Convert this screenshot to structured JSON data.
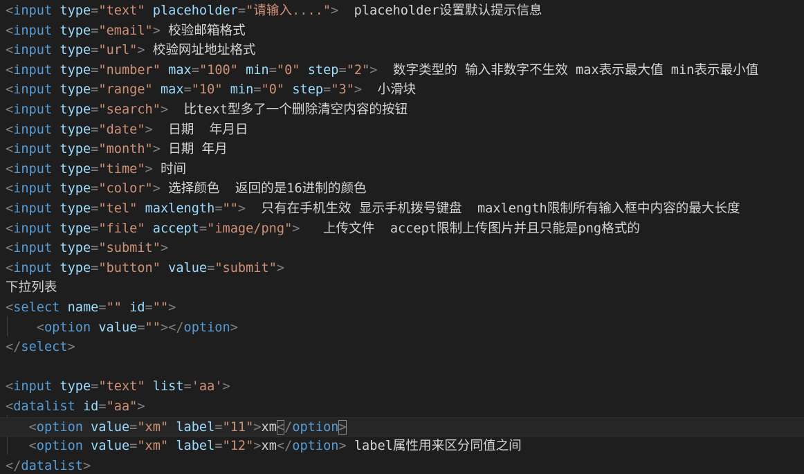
{
  "editor": {
    "lines": [
      [
        [
          "b",
          "<"
        ],
        [
          "t",
          "input"
        ],
        [
          "s",
          " "
        ],
        [
          "a",
          "type"
        ],
        [
          "b",
          "="
        ],
        [
          "v",
          "\"text\""
        ],
        [
          "s",
          " "
        ],
        [
          "a",
          "placeholder"
        ],
        [
          "b",
          "="
        ],
        [
          "v",
          "\"请输入....\""
        ],
        [
          "b",
          ">"
        ],
        [
          "x",
          "  placeholder设置默认提示信息"
        ]
      ],
      [
        [
          "b",
          "<"
        ],
        [
          "t",
          "input"
        ],
        [
          "s",
          " "
        ],
        [
          "a",
          "type"
        ],
        [
          "b",
          "="
        ],
        [
          "v",
          "\"email\""
        ],
        [
          "b",
          ">"
        ],
        [
          "x",
          " 校验邮箱格式"
        ]
      ],
      [
        [
          "b",
          "<"
        ],
        [
          "t",
          "input"
        ],
        [
          "s",
          " "
        ],
        [
          "a",
          "type"
        ],
        [
          "b",
          "="
        ],
        [
          "v",
          "\"url\""
        ],
        [
          "b",
          ">"
        ],
        [
          "x",
          " 校验网址地址格式"
        ]
      ],
      [
        [
          "b",
          "<"
        ],
        [
          "t",
          "input"
        ],
        [
          "s",
          " "
        ],
        [
          "a",
          "type"
        ],
        [
          "b",
          "="
        ],
        [
          "v",
          "\"number\""
        ],
        [
          "s",
          " "
        ],
        [
          "a",
          "max"
        ],
        [
          "b",
          "="
        ],
        [
          "v",
          "\"100\""
        ],
        [
          "s",
          " "
        ],
        [
          "a",
          "min"
        ],
        [
          "b",
          "="
        ],
        [
          "v",
          "\"0\""
        ],
        [
          "s",
          " "
        ],
        [
          "a",
          "step"
        ],
        [
          "b",
          "="
        ],
        [
          "v",
          "\"2\""
        ],
        [
          "b",
          ">"
        ],
        [
          "x",
          "  数字类型的 输入非数字不生效 max表示最大值 min表示最小值"
        ]
      ],
      [
        [
          "b",
          "<"
        ],
        [
          "t",
          "input"
        ],
        [
          "s",
          " "
        ],
        [
          "a",
          "type"
        ],
        [
          "b",
          "="
        ],
        [
          "v",
          "\"range\""
        ],
        [
          "s",
          " "
        ],
        [
          "a",
          "max"
        ],
        [
          "b",
          "="
        ],
        [
          "v",
          "\"10\""
        ],
        [
          "s",
          " "
        ],
        [
          "a",
          "min"
        ],
        [
          "b",
          "="
        ],
        [
          "v",
          "\"0\""
        ],
        [
          "s",
          " "
        ],
        [
          "a",
          "step"
        ],
        [
          "b",
          "="
        ],
        [
          "v",
          "\"3\""
        ],
        [
          "b",
          ">"
        ],
        [
          "x",
          "  小滑块"
        ]
      ],
      [
        [
          "b",
          "<"
        ],
        [
          "t",
          "input"
        ],
        [
          "s",
          " "
        ],
        [
          "a",
          "type"
        ],
        [
          "b",
          "="
        ],
        [
          "v",
          "\"search\""
        ],
        [
          "b",
          ">"
        ],
        [
          "x",
          "  比text型多了一个删除清空内容的按钮"
        ]
      ],
      [
        [
          "b",
          "<"
        ],
        [
          "t",
          "input"
        ],
        [
          "s",
          " "
        ],
        [
          "a",
          "type"
        ],
        [
          "b",
          "="
        ],
        [
          "v",
          "\"date\""
        ],
        [
          "b",
          ">"
        ],
        [
          "x",
          "  日期  年月日"
        ]
      ],
      [
        [
          "b",
          "<"
        ],
        [
          "t",
          "input"
        ],
        [
          "s",
          " "
        ],
        [
          "a",
          "type"
        ],
        [
          "b",
          "="
        ],
        [
          "v",
          "\"month\""
        ],
        [
          "b",
          ">"
        ],
        [
          "x",
          " 日期 年月"
        ]
      ],
      [
        [
          "b",
          "<"
        ],
        [
          "t",
          "input"
        ],
        [
          "s",
          " "
        ],
        [
          "a",
          "type"
        ],
        [
          "b",
          "="
        ],
        [
          "v",
          "\"time\""
        ],
        [
          "b",
          ">"
        ],
        [
          "x",
          " 时间"
        ]
      ],
      [
        [
          "b",
          "<"
        ],
        [
          "t",
          "input"
        ],
        [
          "s",
          " "
        ],
        [
          "a",
          "type"
        ],
        [
          "b",
          "="
        ],
        [
          "v",
          "\"color\""
        ],
        [
          "b",
          ">"
        ],
        [
          "x",
          " 选择颜色  返回的是16进制的颜色"
        ]
      ],
      [
        [
          "b",
          "<"
        ],
        [
          "t",
          "input"
        ],
        [
          "s",
          " "
        ],
        [
          "a",
          "type"
        ],
        [
          "b",
          "="
        ],
        [
          "v",
          "\"tel\""
        ],
        [
          "s",
          " "
        ],
        [
          "a",
          "maxlength"
        ],
        [
          "b",
          "="
        ],
        [
          "v",
          "\"\""
        ],
        [
          "b",
          ">"
        ],
        [
          "x",
          "  只有在手机生效 显示手机拨号键盘  maxlength限制所有输入框中内容的最大长度"
        ]
      ],
      [
        [
          "b",
          "<"
        ],
        [
          "t",
          "input"
        ],
        [
          "s",
          " "
        ],
        [
          "a",
          "type"
        ],
        [
          "b",
          "="
        ],
        [
          "v",
          "\"file\""
        ],
        [
          "s",
          " "
        ],
        [
          "a",
          "accept"
        ],
        [
          "b",
          "="
        ],
        [
          "v",
          "\"image/png\""
        ],
        [
          "b",
          ">"
        ],
        [
          "x",
          "   上传文件  accept限制上传图片并且只能是png格式的"
        ]
      ],
      [
        [
          "b",
          "<"
        ],
        [
          "t",
          "input"
        ],
        [
          "s",
          " "
        ],
        [
          "a",
          "type"
        ],
        [
          "b",
          "="
        ],
        [
          "v",
          "\"submit\""
        ],
        [
          "b",
          ">"
        ]
      ],
      [
        [
          "b",
          "<"
        ],
        [
          "t",
          "input"
        ],
        [
          "s",
          " "
        ],
        [
          "a",
          "type"
        ],
        [
          "b",
          "="
        ],
        [
          "v",
          "\"button\""
        ],
        [
          "s",
          " "
        ],
        [
          "a",
          "value"
        ],
        [
          "b",
          "="
        ],
        [
          "v",
          "\"submit\""
        ],
        [
          "b",
          ">"
        ]
      ],
      [
        [
          "x",
          "下拉列表"
        ]
      ],
      [
        [
          "b",
          "<"
        ],
        [
          "t",
          "select"
        ],
        [
          "s",
          " "
        ],
        [
          "a",
          "name"
        ],
        [
          "b",
          "="
        ],
        [
          "v",
          "\"\""
        ],
        [
          "s",
          " "
        ],
        [
          "a",
          "id"
        ],
        [
          "b",
          "="
        ],
        [
          "v",
          "\"\""
        ],
        [
          "b",
          ">"
        ]
      ],
      [
        [
          "s",
          "    "
        ],
        [
          "b",
          "<"
        ],
        [
          "t",
          "option"
        ],
        [
          "s",
          " "
        ],
        [
          "a",
          "value"
        ],
        [
          "b",
          "="
        ],
        [
          "v",
          "\"\""
        ],
        [
          "b",
          "></"
        ],
        [
          "t",
          "option"
        ],
        [
          "b",
          ">"
        ]
      ],
      [
        [
          "b",
          "</"
        ],
        [
          "t",
          "select"
        ],
        [
          "b",
          ">"
        ]
      ],
      [],
      [
        [
          "b",
          "<"
        ],
        [
          "t",
          "input"
        ],
        [
          "s",
          " "
        ],
        [
          "a",
          "type"
        ],
        [
          "b",
          "="
        ],
        [
          "v",
          "\"text\""
        ],
        [
          "s",
          " "
        ],
        [
          "a",
          "list"
        ],
        [
          "b",
          "="
        ],
        [
          "v",
          "'aa'"
        ],
        [
          "b",
          ">"
        ]
      ],
      [
        [
          "b",
          "<"
        ],
        [
          "t",
          "datalist"
        ],
        [
          "s",
          " "
        ],
        [
          "a",
          "id"
        ],
        [
          "b",
          "="
        ],
        [
          "v",
          "\"aa\""
        ],
        [
          "b",
          ">"
        ]
      ],
      [
        [
          "s",
          "   "
        ],
        [
          "b",
          "<"
        ],
        [
          "t",
          "option"
        ],
        [
          "s",
          " "
        ],
        [
          "a",
          "value"
        ],
        [
          "b",
          "="
        ],
        [
          "v",
          "\"xm\""
        ],
        [
          "s",
          " "
        ],
        [
          "a",
          "label"
        ],
        [
          "b",
          "="
        ],
        [
          "v",
          "\"11\""
        ],
        [
          "b",
          ">"
        ],
        [
          "x",
          "xm"
        ],
        [
          "m",
          "<"
        ],
        [
          "b",
          "/"
        ],
        [
          "t",
          "option"
        ],
        [
          "m",
          ">"
        ]
      ],
      [
        [
          "s",
          "   "
        ],
        [
          "b",
          "<"
        ],
        [
          "t",
          "option"
        ],
        [
          "s",
          " "
        ],
        [
          "a",
          "value"
        ],
        [
          "b",
          "="
        ],
        [
          "v",
          "\"xm\""
        ],
        [
          "s",
          " "
        ],
        [
          "a",
          "label"
        ],
        [
          "b",
          "="
        ],
        [
          "v",
          "\"12\""
        ],
        [
          "b",
          ">"
        ],
        [
          "x",
          "xm"
        ],
        [
          "b",
          "</"
        ],
        [
          "t",
          "option"
        ],
        [
          "b",
          ">"
        ],
        [
          "x",
          " label属性用来区分同值之间"
        ]
      ],
      [
        [
          "b",
          "</"
        ],
        [
          "t",
          "datalist"
        ],
        [
          "b",
          ">"
        ]
      ]
    ],
    "current_line": 21,
    "colors": {
      "background": "#1e1e1e",
      "tag": "#569cd6",
      "attribute": "#9cdcfe",
      "string": "#ce9178",
      "text": "#d4d4d4",
      "punctuation": "#808080"
    }
  }
}
